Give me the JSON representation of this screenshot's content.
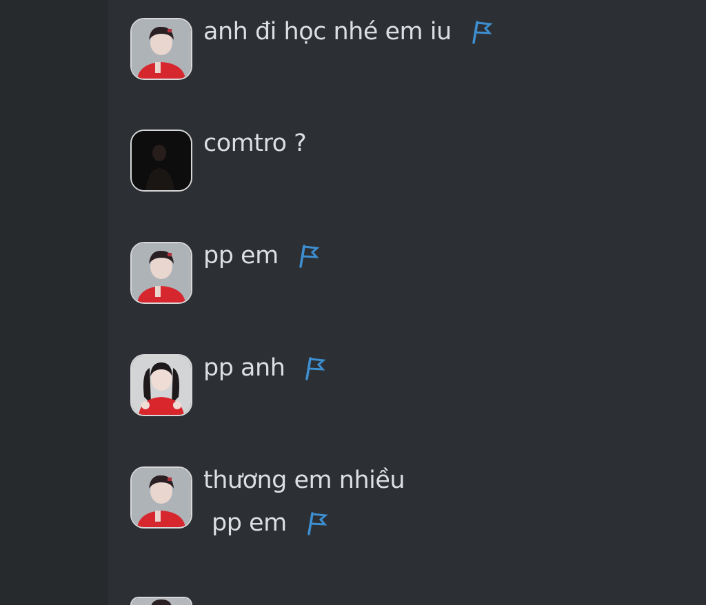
{
  "messages": [
    {
      "id": "m1",
      "avatar": "avatar-girl-red-shirt",
      "lines": [
        "anh đi học nhé em iu"
      ],
      "flag": true
    },
    {
      "id": "m2",
      "avatar": "avatar-dark-photo",
      "lines": [
        "comtro ?"
      ],
      "flag": false
    },
    {
      "id": "m3",
      "avatar": "avatar-girl-red-shirt",
      "lines": [
        "pp em"
      ],
      "flag": true
    },
    {
      "id": "m4",
      "avatar": "avatar-girl-twintails",
      "lines": [
        "pp anh"
      ],
      "flag": true
    },
    {
      "id": "m5",
      "avatar": "avatar-girl-red-shirt",
      "lines": [
        "thương em nhiều",
        "pp em"
      ],
      "flag": true
    }
  ],
  "icons": {
    "flag": "flag-icon"
  },
  "colors": {
    "background": "#2c3034",
    "sidebar": "#262a2d",
    "text": "#dcdfe2",
    "flag": "#3d8fd1"
  }
}
